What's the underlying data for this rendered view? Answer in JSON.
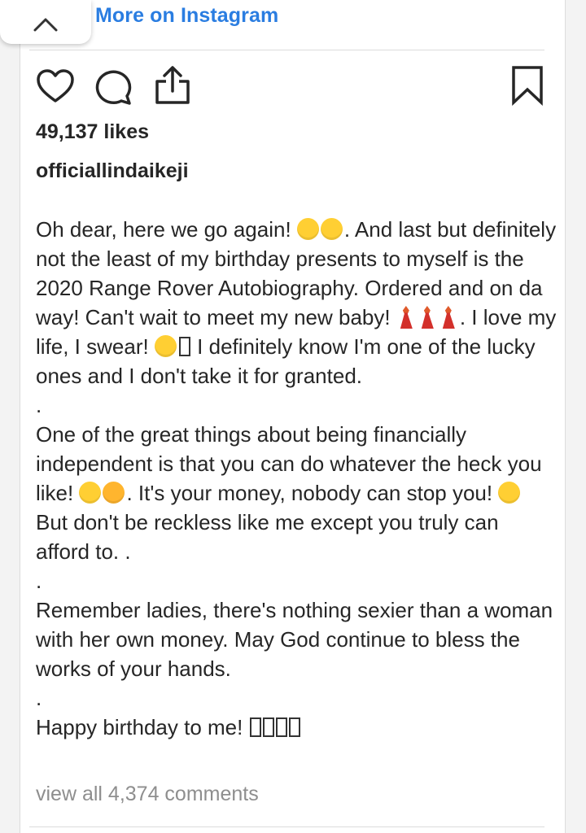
{
  "header": {
    "more_link_label": "More on Instagram",
    "collapse_icon": "chevron-up-icon"
  },
  "actions": {
    "like_icon": "heart-icon",
    "comment_icon": "comment-icon",
    "share_icon": "share-icon",
    "save_icon": "bookmark-icon"
  },
  "post": {
    "likes": "49,137 likes",
    "username": "officiallindaikeji",
    "caption": {
      "p1_a": "Oh dear, here we go again!",
      "p1_b": ". And last but definitely not the least of my birthday presents to myself is the 2020 Range Rover Autobiography. Ordered and on da way! Can't wait to meet my new baby!",
      "p1_c": ". I love my life, I swear!",
      "p1_d": " I definitely know I'm one of the lucky ones and I don't take it for granted.",
      "dot1": ".",
      "p2_a": "One of the great things about being financially independent is that you can do whatever the heck you like!",
      "p2_b": ". It's your money, nobody can stop you!",
      "p2_c": " But don't be reckless like me except you truly can afford to. .",
      "dot2": ".",
      "p3": "Remember ladies, there's nothing sexier than a woman with her own money. May God continue to bless the works of your hands.",
      "dot3": ".",
      "p4": "Happy birthday to me!"
    },
    "view_comments": "view all 4,374 comments"
  },
  "colors": {
    "link": "#2a7de1",
    "text": "#262626",
    "muted": "#8e8e8e",
    "emoji": "#ffcf33"
  }
}
